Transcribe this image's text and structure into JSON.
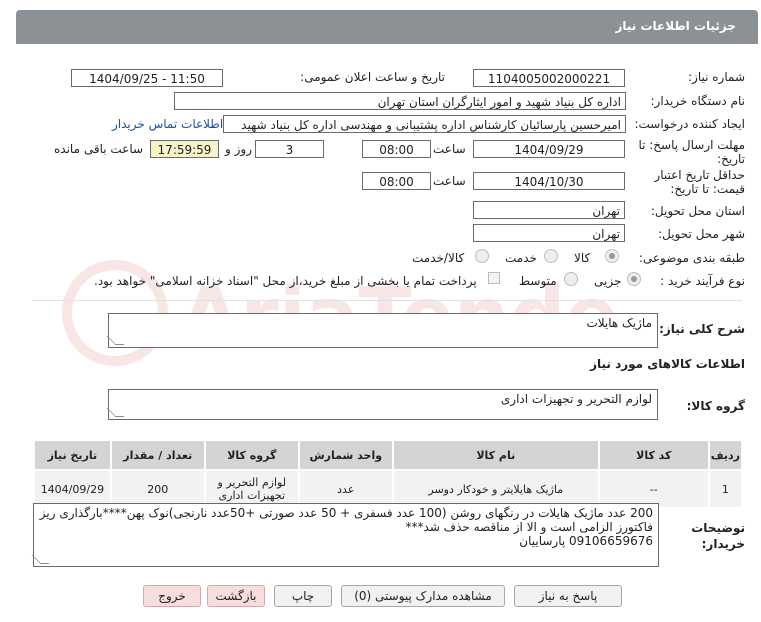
{
  "header": {
    "title": "جزئیات اطلاعات نیاز"
  },
  "fields": {
    "need_number_label": "شماره نیاز:",
    "need_number": "1104005002000221",
    "announce_label": "تاریخ و ساعت اعلان عمومی:",
    "announce_value": "1404/09/25 - 11:50",
    "buyer_org_label": "نام دستگاه خریدار:",
    "buyer_org": "اداره کل بنیاد شهید و امور ایثارگران استان تهران",
    "requester_label": "ایجاد کننده درخواست:",
    "requester": "امیرحسین پارسائیان کارشناس اداره پشتیبانی و مهندسی  اداره کل بنیاد شهید",
    "contact_link": "اطلاعات تماس خریدار",
    "reply_deadline_label": "مهلت ارسال پاسخ: تا تاریخ:",
    "reply_date": "1404/09/29",
    "time_label": "ساعت",
    "reply_time": "08:00",
    "days_value": "3",
    "days_label": "روز و",
    "remaining_time": "17:59:59",
    "remaining_label": "ساعت باقی مانده",
    "validity_label": "حداقل تاریخ اعتبار قیمت: تا تاریخ:",
    "validity_date": "1404/10/30",
    "validity_time": "08:00",
    "province_label": "استان محل تحویل:",
    "province": "تهران",
    "city_label": "شهر محل تحویل:",
    "city": "تهران",
    "category_label": "طبقه بندی موضوعی:",
    "category_options": [
      "کالا",
      "خدمت",
      "کالا/خدمت"
    ],
    "process_label": "نوع فرآیند خرید :",
    "process_options": [
      "جزیی",
      "متوسط"
    ],
    "treasury_note": "پرداخت تمام یا بخشی از مبلغ خرید،از محل \"اسناد خزانه اسلامی\" خواهد بود."
  },
  "summary": {
    "label": "شرح کلی نیاز:",
    "value": "ماژیک هایلات"
  },
  "goods_section": {
    "title": "اطلاعات کالاهای مورد نیاز",
    "group_label": "گروه کالا:",
    "group_value": "لوازم التحریر و تجهیزات اداری"
  },
  "table": {
    "headers": [
      "ردیف",
      "کد کالا",
      "نام کالا",
      "واحد شمارش",
      "گروه کالا",
      "تعداد / مقدار",
      "تاریخ نیاز"
    ],
    "rows": [
      [
        "1",
        "--",
        "ماژیک هایلایتر و خودکار دوسر",
        "عدد",
        "لوازم التحریر و تجهیزات اداری",
        "200",
        "1404/09/29"
      ]
    ]
  },
  "buyer_notes": {
    "label": "توضیحات خریدار:",
    "lines": [
      "200 عدد ماژیک هایلات  در رنگهای روشن (100 عدد فسفری + 50 عدد صورتی +50عدد نارنجی)نوک پهن****بارگذاری ریز",
      "فاکتورز الزامی است و الا از مناقصه حذف شد***",
      "09106659676 پارساییان"
    ]
  },
  "buttons": {
    "reply": "پاسخ به نیاز",
    "attachments": "مشاهده مدارک پیوستی (0)",
    "print": "چاپ",
    "back": "بازگشت",
    "exit": "خروج"
  },
  "watermark_text": "AriaTender.net"
}
